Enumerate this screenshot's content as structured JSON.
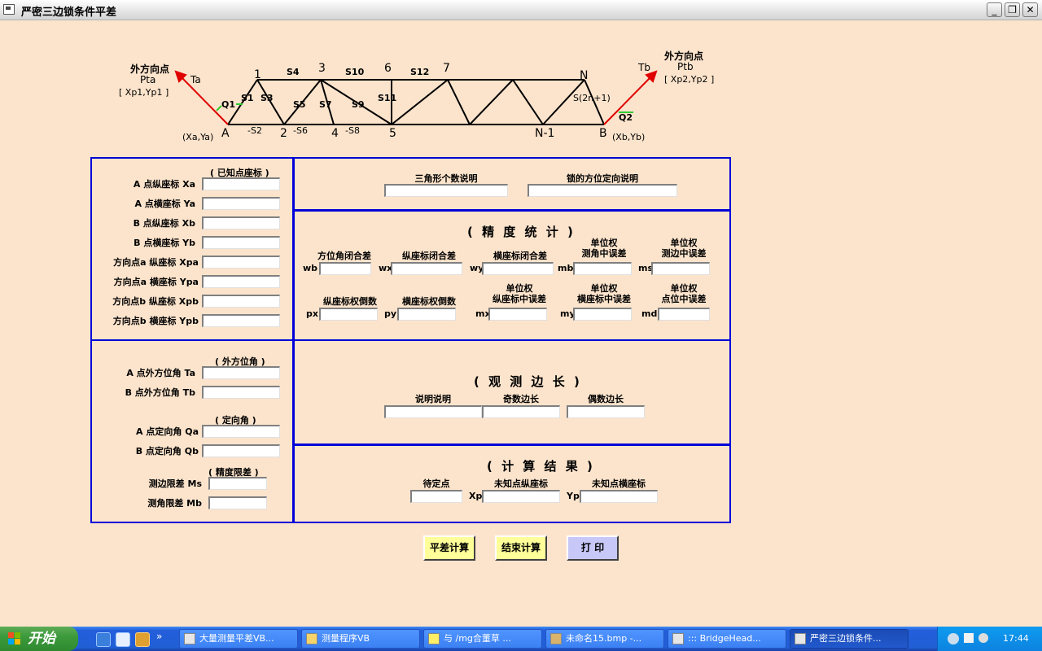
{
  "window": {
    "title": "严密三边锁条件平差",
    "min": "_",
    "restore": "❐",
    "close": "✕"
  },
  "diagram": {
    "left_point_title": "外方向点",
    "left_point_name": "Pta",
    "left_point_coords": "[ Xp1,Yp1 ]",
    "right_point_title": "外方向点",
    "right_point_name": "Ptb",
    "right_point_coords": "[ Xp2,Yp2 ]",
    "Ta": "Ta",
    "Tb": "Tb",
    "Q1": "Q1",
    "Q2": "Q2",
    "A": "A",
    "B": "B",
    "XaYa": "(Xa,Ya)",
    "XbYb": "(Xb,Yb)",
    "n1": "1",
    "n2": "2",
    "n3": "3",
    "n4": "4",
    "n5": "5",
    "n6": "6",
    "n7": "7",
    "nN": "N",
    "nN1": "N-1",
    "S1": "S1",
    "S2": "-S2",
    "S3": "S3",
    "S4": "S4",
    "S5": "S5",
    "S6": "-S6",
    "S7": "S7",
    "S8": "-S8",
    "S9": "S9",
    "S10": "S10",
    "S11": "S11",
    "S12": "S12",
    "S2n1": "S(2n+1)"
  },
  "known": {
    "header": "( 已知点座标 )",
    "fields": [
      "A 点纵座标 Xa",
      "A 点横座标 Ya",
      "B 点纵座标 Xb",
      "B 点横座标 Yb",
      "方向点a 纵座标 Xpa",
      "方向点a 横座标 Ypa",
      "方向点b 纵座标 Xpb",
      "方向点b 横座标 Ypb"
    ]
  },
  "angles": {
    "ext_header": "( 外方位角 )",
    "Ta_label": "A 点外方位角 Ta",
    "Tb_label": "B 点外方位角 Tb",
    "ori_header": "( 定向角 )",
    "Qa_label": "A 点定向角 Qa",
    "Qb_label": "B 点定向角 Qb",
    "lim_header": "( 精度限差 )",
    "Ms_label": "测边限差 Ms",
    "Mb_label": "测角限差 Mb"
  },
  "info": {
    "triangles": "三角形个数说明",
    "orientation": "锁的方位定向说明"
  },
  "precision": {
    "title": "( 精 度 统 计 )",
    "wb_head": "方位角闭合差",
    "wx_head": "纵座标闭合差",
    "wy_head": "横座标闭合差",
    "mb_head1": "单位权",
    "mb_head2": "测角中误差",
    "ms_head1": "单位权",
    "ms_head2": "测边中误差",
    "wb": "wb",
    "wx": "wx",
    "wy": "wy",
    "mb": "mb",
    "ms": "ms",
    "px_head": "纵座标权倒数",
    "py_head": "横座标权倒数",
    "mx_head1": "单位权",
    "mx_head2": "纵座标中误差",
    "my_head1": "单位权",
    "my_head2": "横座标中误差",
    "md_head1": "单位权",
    "md_head2": "点位中误差",
    "px": "px",
    "py": "py",
    "mx": "mx",
    "my": "my",
    "md": "md"
  },
  "observed": {
    "title": "( 观 测 边 长 )",
    "desc": "说明说明",
    "odd": "奇数边长",
    "even": "偶数边长"
  },
  "results": {
    "title": "( 计 算 结 果 )",
    "point": "待定点",
    "x_head": "未知点纵座标",
    "y_head": "未知点横座标",
    "xp": "Xp",
    "yp": "Yp"
  },
  "buttons": {
    "compute": "平差计算",
    "finish": "结束计算",
    "print": "打 印"
  },
  "taskbar": {
    "start": "开始",
    "tasks": [
      "大量测量平差VB...",
      "测量程序VB",
      "与 /mg合董草 ...",
      "未命名15.bmp -...",
      "::: BridgeHead...",
      "严密三边锁条件..."
    ],
    "time": "17:44"
  }
}
